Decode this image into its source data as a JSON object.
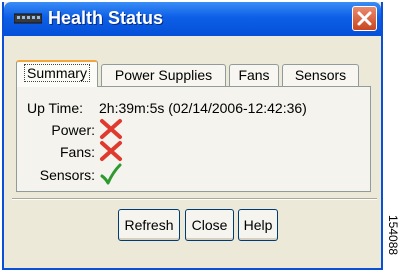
{
  "window": {
    "title": "Health Status",
    "icon": "device-icon",
    "close_icon": "close-icon"
  },
  "tabs": [
    {
      "label": "Summary",
      "active": true
    },
    {
      "label": "Power Supplies",
      "active": false
    },
    {
      "label": "Fans",
      "active": false
    },
    {
      "label": "Sensors",
      "active": false
    }
  ],
  "summary": {
    "uptime_label": "Up Time:",
    "uptime_value": "2h:39m:5s (02/14/2006-12:42:36)",
    "power_label": "Power:",
    "power_status_icon": "red-x-icon",
    "fans_label": "Fans:",
    "fans_status_icon": "red-x-icon",
    "sensors_label": "Sensors:",
    "sensors_status_icon": "green-check-icon"
  },
  "buttons": {
    "refresh": "Refresh",
    "close": "Close",
    "help": "Help"
  },
  "figure_id": "154088",
  "colors": {
    "title_bar": "#0d5fe6",
    "error": "#e03a2e",
    "ok": "#2e9a2e"
  }
}
